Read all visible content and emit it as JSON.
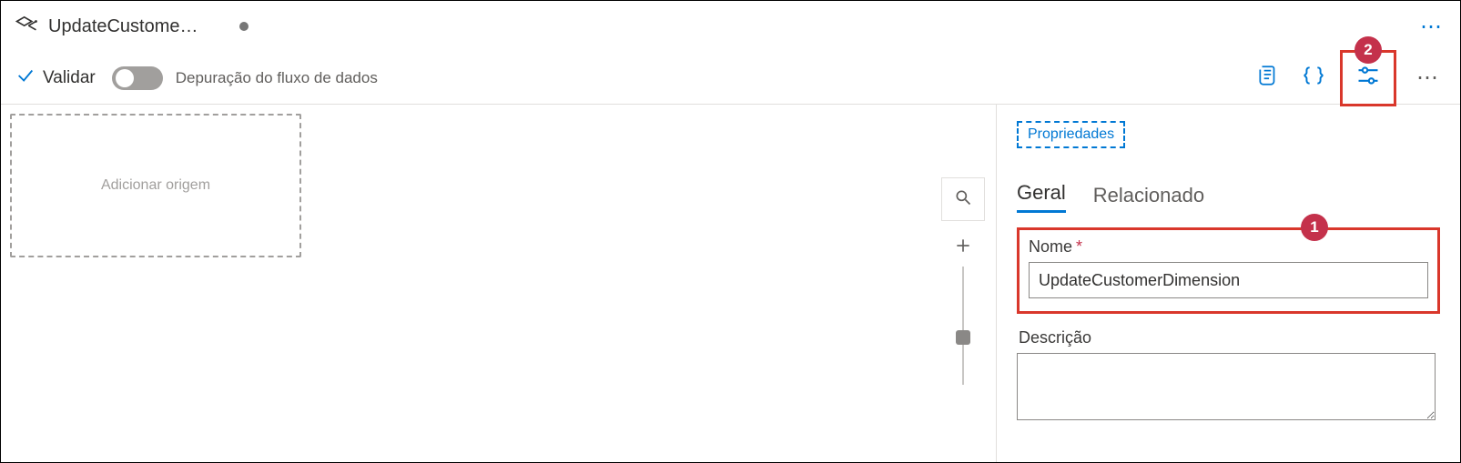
{
  "titlebar": {
    "tab_title": "UpdateCustomerDi..."
  },
  "toolbar": {
    "validate_label": "Validar",
    "debug_label": "Depuração do fluxo de dados"
  },
  "canvas": {
    "add_source_label": "Adicionar origem"
  },
  "side": {
    "properties_label": "Propriedades",
    "tabs": {
      "general": "Geral",
      "related": "Relacionado"
    },
    "name_label": "Nome",
    "name_value": "UpdateCustomerDimension",
    "description_label": "Descrição",
    "description_value": ""
  },
  "callouts": {
    "one": "1",
    "two": "2"
  }
}
